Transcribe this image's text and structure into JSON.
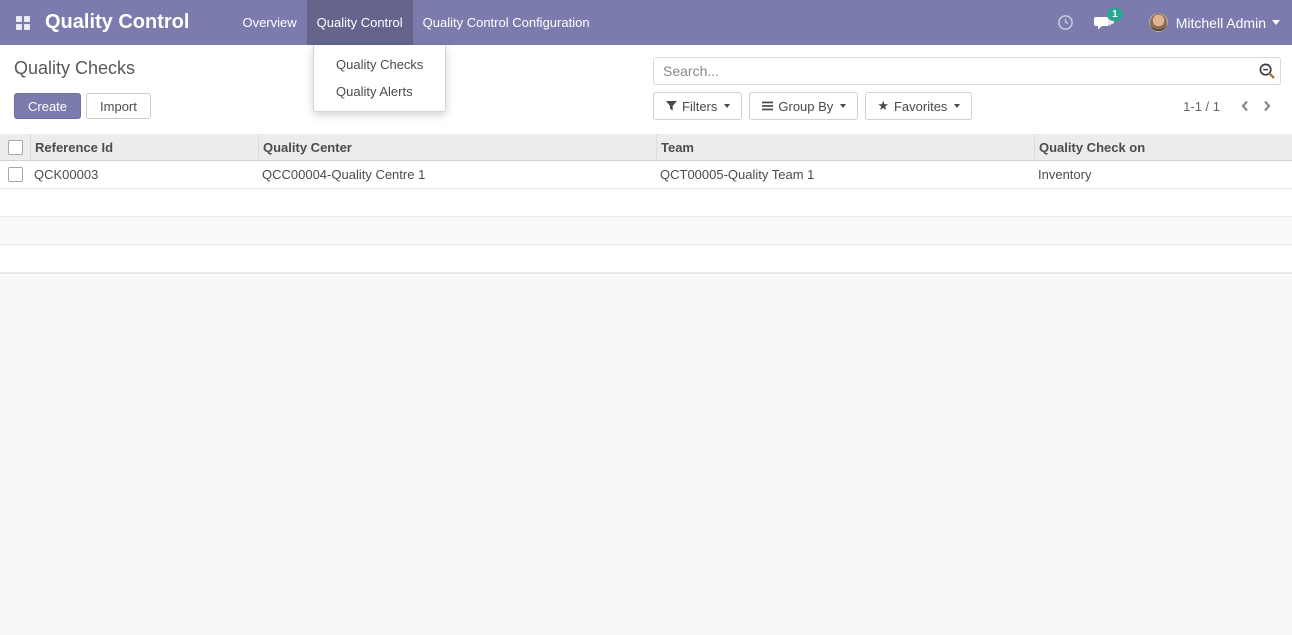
{
  "navbar": {
    "brand": "Quality Control",
    "menus": [
      {
        "label": "Overview"
      },
      {
        "label": "Quality Control"
      },
      {
        "label": "Quality Control Configuration"
      }
    ],
    "active_menu": "Quality Control",
    "message_count": "1",
    "user_name": "Mitchell Admin"
  },
  "quality_control_dropdown": {
    "items": [
      {
        "label": "Quality Checks"
      },
      {
        "label": "Quality Alerts"
      }
    ]
  },
  "control_panel": {
    "title": "Quality Checks",
    "create_button": "Create",
    "import_button": "Import",
    "search": {
      "placeholder": "Search...",
      "value": ""
    },
    "filters_button": "Filters",
    "group_by_button": "Group By",
    "favorites_button": "Favorites",
    "pager": {
      "text": "1-1 / 1"
    }
  },
  "table": {
    "columns": [
      "Reference Id",
      "Quality Center",
      "Team",
      "Quality Check on"
    ],
    "rows": [
      {
        "reference_id": "QCK00003",
        "quality_center": "QCC00004-Quality Centre 1",
        "team": "QCT00005-Quality Team 1",
        "quality_check_on": "Inventory"
      }
    ]
  },
  "icons": {
    "favorites_star": "★"
  },
  "colors": {
    "navbar_bg": "#7b7bad",
    "navbar_active_bg": "#62618f",
    "primary_button_bg": "#7c7bad",
    "message_badge_bg": "#28a791",
    "table_header_bg": "#ececec",
    "stripe_row_bg": "#f9f9f9",
    "page_bg_below_table": "#f8f8f8"
  }
}
